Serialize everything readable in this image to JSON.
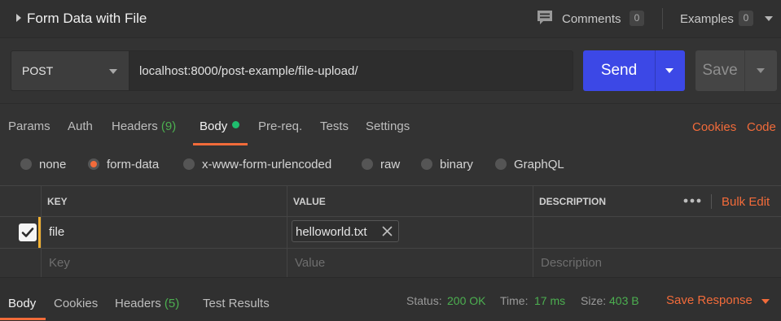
{
  "request": {
    "title": "Form Data with File",
    "comments_label": "Comments",
    "comments_count": "0",
    "examples_label": "Examples",
    "examples_count": "0"
  },
  "url_bar": {
    "method": "POST",
    "url": "localhost:8000/post-example/file-upload/",
    "send_label": "Send",
    "save_label": "Save"
  },
  "tabs": {
    "items": [
      {
        "label": "Params"
      },
      {
        "label": "Auth"
      },
      {
        "label": "Headers",
        "count": "(9)"
      },
      {
        "label": "Body",
        "active": true,
        "indicator": "green-dot"
      },
      {
        "label": "Pre-req."
      },
      {
        "label": "Tests"
      },
      {
        "label": "Settings"
      }
    ],
    "cookies_link": "Cookies",
    "code_link": "Code"
  },
  "body_types": {
    "options": [
      "none",
      "form-data",
      "x-www-form-urlencoded",
      "raw",
      "binary",
      "GraphQL"
    ],
    "selected": "form-data"
  },
  "form_table": {
    "headers": {
      "key": "KEY",
      "value": "VALUE",
      "description": "DESCRIPTION"
    },
    "bulk_edit": "Bulk Edit",
    "rows": [
      {
        "checked": true,
        "key": "file",
        "value_file": "helloworld.txt",
        "description": ""
      }
    ],
    "placeholders": {
      "key": "Key",
      "value": "Value",
      "description": "Description"
    }
  },
  "response": {
    "tabs": [
      {
        "label": "Body",
        "active": true
      },
      {
        "label": "Cookies"
      },
      {
        "label": "Headers",
        "count": "(5)"
      },
      {
        "label": "Test Results"
      }
    ],
    "status_label": "Status:",
    "status_value": "200 OK",
    "time_label": "Time:",
    "time_value": "17 ms",
    "size_label": "Size:",
    "size_value": "403 B",
    "save_response": "Save Response"
  },
  "colors": {
    "accent": "#f26b3a",
    "send": "#3c48e6",
    "success": "#4caf50",
    "row_indicator": "#f2b132"
  }
}
